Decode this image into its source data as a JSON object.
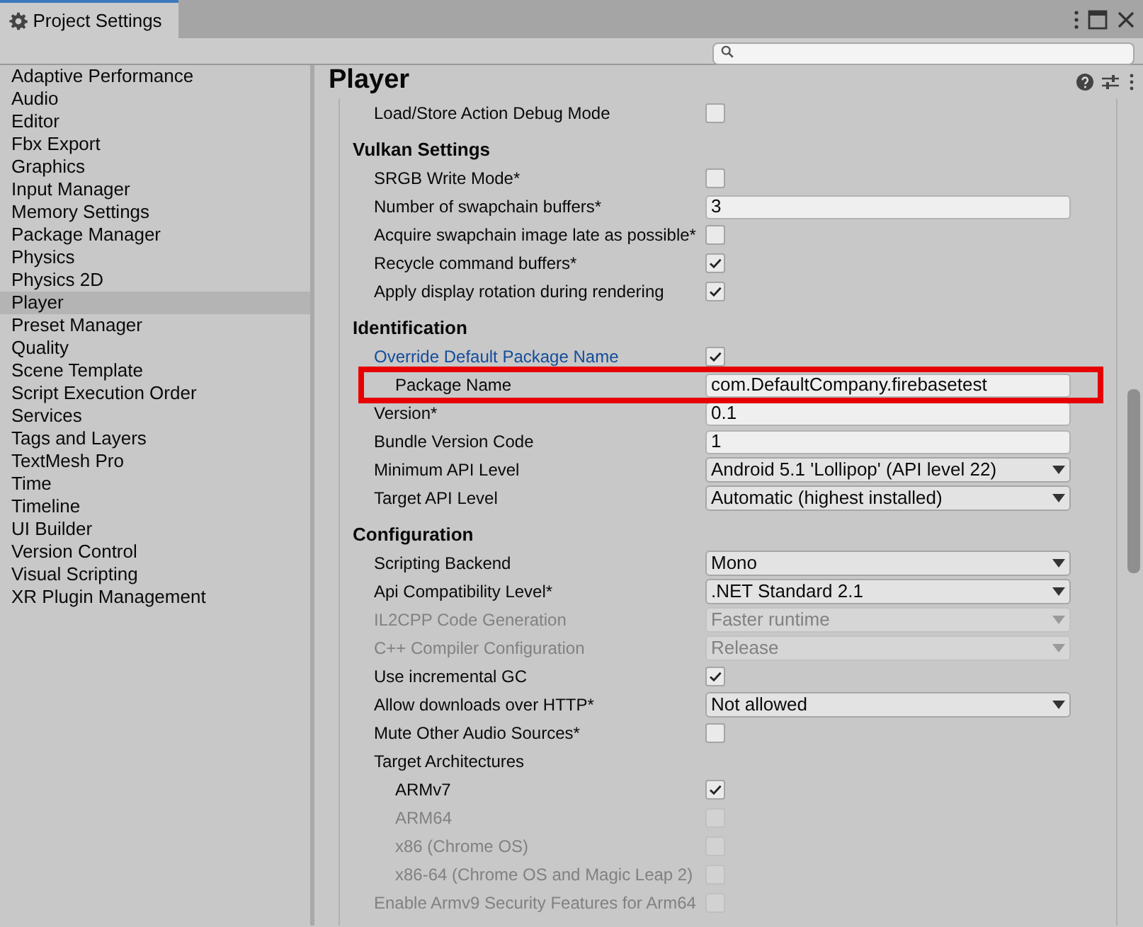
{
  "window": {
    "tab_title": "Project Settings"
  },
  "sidebar": {
    "items": [
      {
        "label": "Adaptive Performance",
        "selected": false
      },
      {
        "label": "Audio",
        "selected": false
      },
      {
        "label": "Editor",
        "selected": false
      },
      {
        "label": "Fbx Export",
        "selected": false
      },
      {
        "label": "Graphics",
        "selected": false
      },
      {
        "label": "Input Manager",
        "selected": false
      },
      {
        "label": "Memory Settings",
        "selected": false
      },
      {
        "label": "Package Manager",
        "selected": false
      },
      {
        "label": "Physics",
        "selected": false
      },
      {
        "label": "Physics 2D",
        "selected": false
      },
      {
        "label": "Player",
        "selected": true
      },
      {
        "label": "Preset Manager",
        "selected": false
      },
      {
        "label": "Quality",
        "selected": false
      },
      {
        "label": "Scene Template",
        "selected": false
      },
      {
        "label": "Script Execution Order",
        "selected": false
      },
      {
        "label": "Services",
        "selected": false
      },
      {
        "label": "Tags and Layers",
        "selected": false
      },
      {
        "label": "TextMesh Pro",
        "selected": false
      },
      {
        "label": "Time",
        "selected": false
      },
      {
        "label": "Timeline",
        "selected": false
      },
      {
        "label": "UI Builder",
        "selected": false
      },
      {
        "label": "Version Control",
        "selected": false
      },
      {
        "label": "Visual Scripting",
        "selected": false
      },
      {
        "label": "XR Plugin Management",
        "selected": false
      }
    ]
  },
  "inspector": {
    "title": "Player",
    "rows": [
      {
        "kind": "check",
        "label": "Load/Store Action Debug Mode",
        "checked": false,
        "disabled": false
      },
      {
        "kind": "header",
        "label": "Vulkan Settings"
      },
      {
        "kind": "check",
        "label": "SRGB Write Mode*",
        "checked": false,
        "disabled": false
      },
      {
        "kind": "text",
        "label": "Number of swapchain buffers*",
        "value": "3",
        "disabled": false
      },
      {
        "kind": "check",
        "label": "Acquire swapchain image late as possible*",
        "checked": false,
        "disabled": false
      },
      {
        "kind": "check",
        "label": "Recycle command buffers*",
        "checked": true,
        "disabled": false
      },
      {
        "kind": "check",
        "label": "Apply display rotation during rendering",
        "checked": true,
        "disabled": false
      },
      {
        "kind": "header",
        "label": "Identification"
      },
      {
        "kind": "check",
        "label": "Override Default Package Name",
        "checked": true,
        "disabled": false,
        "overridden": true
      },
      {
        "kind": "text",
        "label": "Package Name",
        "value": "com.DefaultCompany.firebasetest",
        "disabled": false,
        "nested": true,
        "highlighted": true
      },
      {
        "kind": "text",
        "label": "Version*",
        "value": "0.1",
        "disabled": false
      },
      {
        "kind": "text",
        "label": "Bundle Version Code",
        "value": "1",
        "disabled": false
      },
      {
        "kind": "dropdown",
        "label": "Minimum API Level",
        "value": "Android 5.1 'Lollipop' (API level 22)",
        "disabled": false
      },
      {
        "kind": "dropdown",
        "label": "Target API Level",
        "value": "Automatic (highest installed)",
        "disabled": false
      },
      {
        "kind": "header",
        "label": "Configuration"
      },
      {
        "kind": "dropdown",
        "label": "Scripting Backend",
        "value": "Mono",
        "disabled": false
      },
      {
        "kind": "dropdown",
        "label": "Api Compatibility Level*",
        "value": ".NET Standard 2.1",
        "disabled": false
      },
      {
        "kind": "dropdown",
        "label": "IL2CPP Code Generation",
        "value": "Faster runtime",
        "disabled": true
      },
      {
        "kind": "dropdown",
        "label": "C++ Compiler Configuration",
        "value": "Release",
        "disabled": true
      },
      {
        "kind": "check",
        "label": "Use incremental GC",
        "checked": true,
        "disabled": false
      },
      {
        "kind": "dropdown",
        "label": "Allow downloads over HTTP*",
        "value": "Not allowed",
        "disabled": false
      },
      {
        "kind": "check",
        "label": "Mute Other Audio Sources*",
        "checked": false,
        "disabled": false
      },
      {
        "kind": "label",
        "label": "Target Architectures"
      },
      {
        "kind": "check",
        "label": "ARMv7",
        "checked": true,
        "disabled": false,
        "nested": true
      },
      {
        "kind": "check",
        "label": "ARM64",
        "checked": false,
        "disabled": true,
        "nested": true
      },
      {
        "kind": "check",
        "label": "x86 (Chrome OS)",
        "checked": false,
        "disabled": true,
        "nested": true
      },
      {
        "kind": "check",
        "label": "x86-64 (Chrome OS and Magic Leap 2)",
        "checked": false,
        "disabled": true,
        "nested": true
      },
      {
        "kind": "check",
        "label": "Enable Armv9 Security Features for Arm64",
        "checked": false,
        "disabled": true
      }
    ]
  }
}
